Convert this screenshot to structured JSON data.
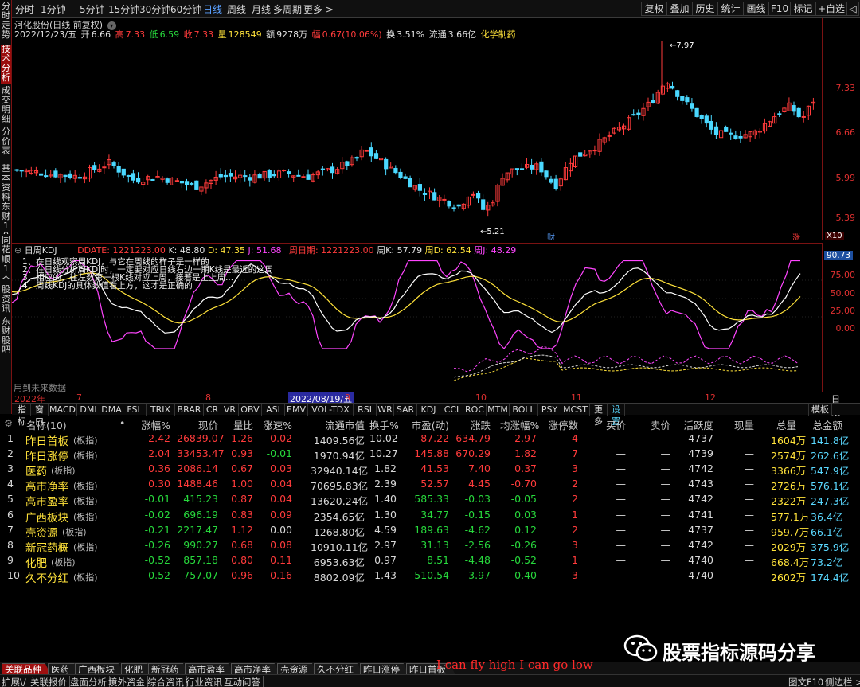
{
  "left_tabs": [
    {
      "label": "分时走势"
    },
    {
      "label": "技术分析",
      "active": true
    },
    {
      "label": "成交明细"
    },
    {
      "label": "分价表"
    },
    {
      "label": "基本资料"
    },
    {
      "label": "东财10"
    },
    {
      "label": "同花顺10"
    },
    {
      "label": "个股资讯"
    },
    {
      "label": "东财股吧"
    }
  ],
  "periods": {
    "fenshi": "分时",
    "m1": "1分钟",
    "m5": "5分钟",
    "m15": "15分钟",
    "m30": "30分钟",
    "m60": "60分钟",
    "day": "日线",
    "week": "周线",
    "month": "月线",
    "multi": "多周期",
    "more": "更多 >"
  },
  "right_buttons": {
    "fuquan": "复权",
    "diejia": "叠加",
    "lishi": "历史",
    "tongji": "统计",
    "huaxian": "画线",
    "f10": "F10",
    "biaoji": "标记",
    "zixuan": "+自选",
    "back": "◁"
  },
  "stock": {
    "name": "河化股份(日线 前复权)",
    "date": "2022/12/23/五",
    "open_label": "开",
    "open": "6.66",
    "high_label": "高",
    "high": "7.33",
    "low_label": "低",
    "low": "6.59",
    "close_label": "收",
    "close": "7.33",
    "vol_label": "量",
    "vol": "128549",
    "amt_label": "额",
    "amt": "9278万",
    "chg_label": "幅",
    "chg": "0.67(10.06%)",
    "turn_label": "换",
    "turn": "3.51%",
    "float_label": "流通",
    "float": "3.66亿",
    "sector": "化学制药"
  },
  "price_axis": {
    "labels": [
      "7.33",
      "6.66",
      "5.99",
      "5.39"
    ],
    "max_mark": "7.97",
    "min_mark": "5.21",
    "cai": "财",
    "zhang": "涨",
    "x10": "X10"
  },
  "kdj": {
    "title": "日周KDJ",
    "ddate": "DDATE: 1221223.00",
    "k": "K: 48.80",
    "d": "D: 47.35",
    "j": "J: 51.68",
    "wdate": "周日期: 1221223.00",
    "wk": "周K: 57.79",
    "wd": "周D: 62.54",
    "wj": "周J: 48.29",
    "axis": [
      "90.73",
      "75.00",
      "50.00",
      "25.00",
      "0.00"
    ],
    "notes": [
      "1、在日线观察周KDJ，与它在周线的样子是一样的",
      "2、在日线分析周KDJ时，一定要对应日线右边一期K线是最近的这周",
      "3、相应的，往左数第一根K线对应上周，接着是上上周...",
      "4、周线KDJ的具体数值看上方，这才是正确的"
    ],
    "future": "用到未来数据"
  },
  "dates": {
    "y2022": "2022年",
    "m7": "7",
    "m8": "8",
    "sel": "2022/08/19/五",
    "m9": "9",
    "m10": "10",
    "m11": "11",
    "m12": "12",
    "period": "日线"
  },
  "ind_tabs": [
    "指标",
    "窗口",
    "MACD",
    "DMI",
    "DMA",
    "FSL",
    "TRIX",
    "BRAR",
    "CR",
    "VR",
    "OBV",
    "ASI",
    "EMV",
    "VOL-TDX",
    "RSI",
    "WR",
    "SAR",
    "KDJ",
    "CCI",
    "ROC",
    "MTM",
    "BOLL",
    "PSY",
    "MCST",
    "更多",
    "设置"
  ],
  "template": "模板",
  "table": {
    "headers": [
      "名称(10)",
      "•",
      "涨幅%",
      "现价",
      "量比",
      "涨速%",
      "流通市值",
      "换手%",
      "市盈(动)",
      "涨跌",
      "均涨幅%",
      "涨停数",
      "买价",
      "卖价",
      "活跃度",
      "现量",
      "总量",
      "总金额"
    ],
    "rows": [
      [
        "1",
        "昨日首板",
        "(板指)",
        "2.42",
        "26839.07",
        "1.26",
        "0.02",
        "1409.56亿",
        "10.02",
        "87.22",
        "634.79",
        "2.97",
        "4",
        "—",
        "—",
        "4737",
        "—",
        "1604万",
        "141.8亿"
      ],
      [
        "2",
        "昨日涨停",
        "(板指)",
        "2.04",
        "33453.47",
        "0.93",
        "-0.01",
        "1970.94亿",
        "10.27",
        "145.88",
        "670.29",
        "1.82",
        "7",
        "—",
        "—",
        "4739",
        "—",
        "2574万",
        "262.6亿"
      ],
      [
        "3",
        "医药",
        "(板指)",
        "0.36",
        "2086.14",
        "0.67",
        "0.03",
        "32940.14亿",
        "1.82",
        "41.53",
        "7.40",
        "0.37",
        "3",
        "—",
        "—",
        "4742",
        "—",
        "3366万",
        "547.9亿"
      ],
      [
        "4",
        "高市净率",
        "(板指)",
        "0.30",
        "1488.46",
        "1.00",
        "0.04",
        "70695.83亿",
        "2.39",
        "52.57",
        "4.45",
        "-0.70",
        "2",
        "—",
        "—",
        "4743",
        "—",
        "2726万",
        "576.1亿"
      ],
      [
        "5",
        "高市盈率",
        "(板指)",
        "-0.01",
        "415.23",
        "0.87",
        "0.04",
        "13620.24亿",
        "1.40",
        "585.33",
        "-0.03",
        "-0.05",
        "2",
        "—",
        "—",
        "4742",
        "—",
        "2322万",
        "247.3亿"
      ],
      [
        "6",
        "广西板块",
        "(板指)",
        "-0.02",
        "696.19",
        "0.83",
        "0.09",
        "2354.65亿",
        "1.30",
        "34.77",
        "-0.15",
        "0.03",
        "1",
        "—",
        "—",
        "4741",
        "—",
        "577.1万",
        "36.4亿"
      ],
      [
        "7",
        "壳资源",
        "(板指)",
        "-0.21",
        "2217.47",
        "1.12",
        "0.00",
        "1268.80亿",
        "4.59",
        "189.63",
        "-4.62",
        "0.12",
        "2",
        "—",
        "—",
        "4737",
        "—",
        "959.7万",
        "66.1亿"
      ],
      [
        "8",
        "新冠药概",
        "(板指)",
        "-0.26",
        "990.27",
        "0.68",
        "0.08",
        "10910.11亿",
        "2.97",
        "31.13",
        "-2.56",
        "-0.26",
        "3",
        "—",
        "—",
        "4742",
        "—",
        "2029万",
        "375.9亿"
      ],
      [
        "9",
        "化肥",
        "(板指)",
        "-0.52",
        "857.18",
        "0.80",
        "0.11",
        "6953.63亿",
        "0.97",
        "8.51",
        "-4.48",
        "-0.52",
        "1",
        "—",
        "—",
        "4740",
        "—",
        "668.4万",
        "73.2亿"
      ],
      [
        "10",
        "久不分红",
        "(板指)",
        "-0.52",
        "757.07",
        "0.96",
        "0.16",
        "8802.09亿",
        "1.43",
        "510.54",
        "-3.97",
        "-0.40",
        "3",
        "—",
        "—",
        "4740",
        "—",
        "2602万",
        "174.4亿"
      ]
    ]
  },
  "bottom_tabs": [
    "关联品种",
    "医药",
    "广西板块",
    "化肥",
    "新冠药",
    "高市盈率",
    "高市净率",
    "壳资源",
    "久不分红",
    "昨日涨停",
    "昨日首板"
  ],
  "status": [
    "扩展\\/",
    "关联报价",
    "盘面分析",
    "境外资金",
    "综合资讯",
    "行业资讯",
    "互动问答"
  ],
  "status_right": {
    "f10": "图文F10",
    "side": "侧边栏 >"
  },
  "watermark": "股票指标源码分享",
  "overlay": "I can fly high I can go low",
  "colors": {
    "up": "#ff3b3b",
    "down": "#27d83c",
    "k": "#ffffff",
    "d": "#ffe23a",
    "j": "#ff45ff",
    "frame": "#7a1212"
  }
}
